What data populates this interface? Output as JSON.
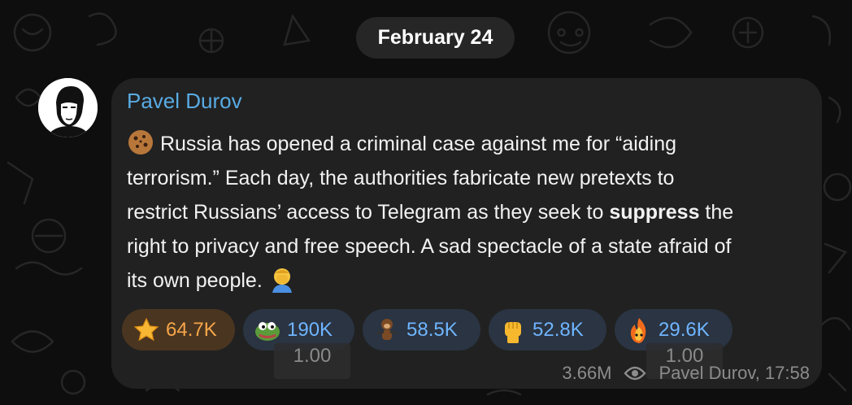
{
  "date_pill": "February 24",
  "message": {
    "sender": "Pavel Durov",
    "lines": [
      {
        "parts": [
          {
            "text": "Russia has opened a criminal case against me for “aiding",
            "bold": false
          }
        ]
      },
      {
        "parts": [
          {
            "text": "terrorism.” Each day, the authorities fabricate new pretexts to",
            "bold": false
          }
        ]
      },
      {
        "parts": [
          {
            "text": "restrict Russians’ access to Telegram as they seek to ",
            "bold": false
          },
          {
            "text": "suppress",
            "bold": true
          },
          {
            "text": " the",
            "bold": false
          }
        ]
      },
      {
        "parts": [
          {
            "text": "right to privacy and free speech. A sad spectacle of a state afraid of",
            "bold": false
          }
        ]
      },
      {
        "parts": [
          {
            "text": "its own people.",
            "bold": false
          }
        ]
      }
    ],
    "lead_emoji": "cookie-icon",
    "trail_emoji": "facepalm-icon"
  },
  "reactions": [
    {
      "icon": "star-icon",
      "count": "64.7K",
      "paid": true
    },
    {
      "icon": "pepe-frog-icon",
      "count": "190K",
      "paid": false
    },
    {
      "icon": "monkey-icon",
      "count": "58.5K",
      "paid": false
    },
    {
      "icon": "raised-fist-icon",
      "count": "52.8K",
      "paid": false
    },
    {
      "icon": "fire-character-icon",
      "count": "29.6K",
      "paid": false
    }
  ],
  "overlays": [
    "1.00",
    "1.00"
  ],
  "footer": {
    "views": "3.66M",
    "signature": "Pavel Durov, 17:58"
  },
  "colors": {
    "background": "#0e0e0e",
    "bubble": "#212121",
    "sender": "#59abe3",
    "reaction_bg": "#2a3442",
    "reaction_text": "#6fb5ff",
    "paid_bg": "#4a3520",
    "paid_text": "#f7a64a"
  }
}
